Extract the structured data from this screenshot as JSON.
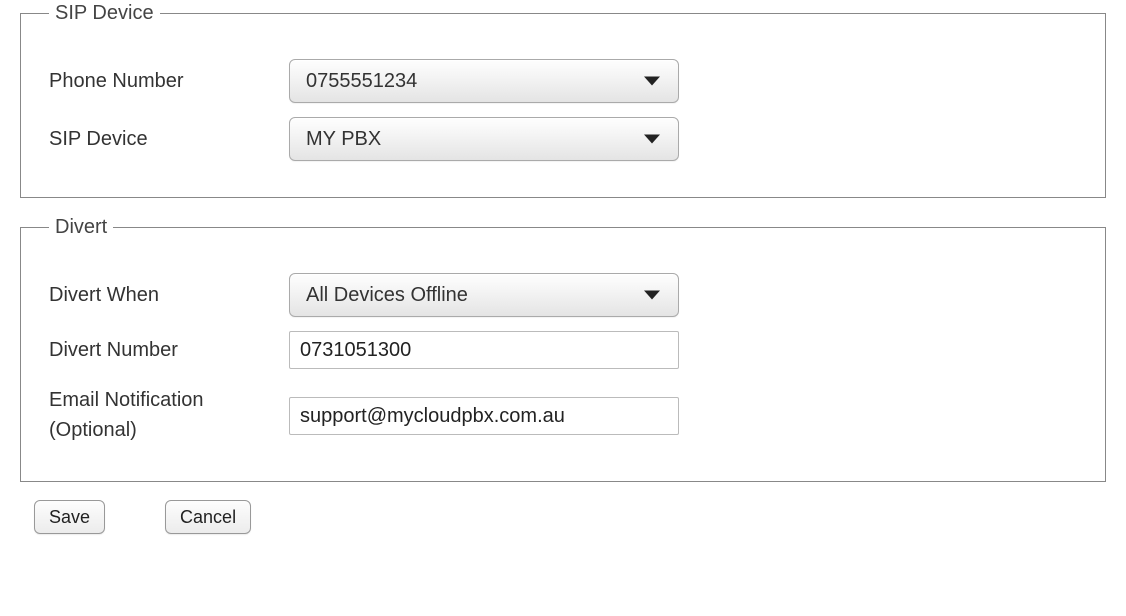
{
  "sections": {
    "sip": {
      "legend": "SIP Device",
      "phone_number_label": "Phone Number",
      "phone_number_value": "0755551234",
      "sip_device_label": "SIP Device",
      "sip_device_value": "MY PBX"
    },
    "divert": {
      "legend": "Divert",
      "divert_when_label": "Divert When",
      "divert_when_value": "All Devices Offline",
      "divert_number_label": "Divert Number",
      "divert_number_value": "0731051300",
      "email_label": "Email Notification (Optional)",
      "email_value": "support@mycloudpbx.com.au"
    }
  },
  "buttons": {
    "save": "Save",
    "cancel": "Cancel"
  }
}
